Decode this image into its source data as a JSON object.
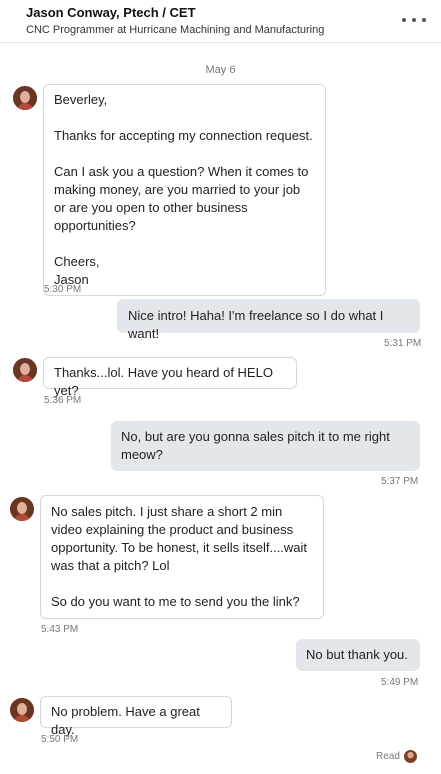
{
  "header": {
    "name": "Jason Conway, Ptech / CET",
    "headline": "CNC Programmer at Hurricane Machining and Manufacturing",
    "more_icon": "ellipsis-icon"
  },
  "date_separator": "May 6",
  "messages": [
    {
      "from": "them",
      "text": "Beverley,\n\nThanks for accepting my connection request.\n\nCan I ask you a question? When it comes to making money, are you married to your job or are you open to other business opportunities?\n\nCheers,\nJason",
      "time": "5:30 PM"
    },
    {
      "from": "me",
      "text": "Nice intro! Haha! I'm freelance so I do what I want!",
      "time": "5:31 PM"
    },
    {
      "from": "them",
      "text": "Thanks...lol. Have you heard of HELO yet?",
      "time": "5:36 PM"
    },
    {
      "from": "me",
      "text": "No, but are you gonna sales pitch it to me right meow?",
      "time": "5:37 PM"
    },
    {
      "from": "them",
      "text": "No sales pitch. I just share a short 2 min video explaining the product and business opportunity. To be honest, it sells itself....wait was that a pitch? Lol\n\nSo do you want to me to send you the link?",
      "time": "5:43 PM"
    },
    {
      "from": "me",
      "text": "No but thank you.",
      "time": "5:49 PM"
    },
    {
      "from": "them",
      "text": "No problem. Have a great day.",
      "time": "5:50 PM"
    }
  ],
  "read_label": "Read"
}
